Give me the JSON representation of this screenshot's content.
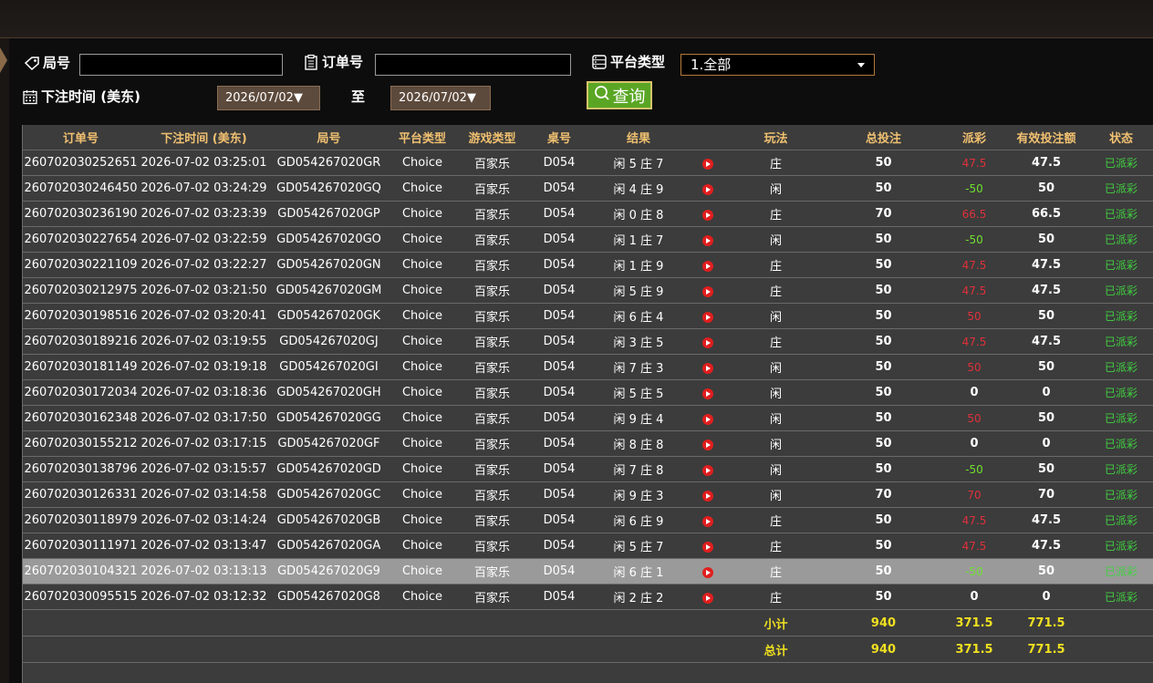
{
  "filters": {
    "round_label": "局号",
    "order_label": "订单号",
    "platform_label": "平台类型",
    "platform_selected": "1.全部",
    "time_label": "下注时间 (美东)",
    "date_from": "2026/07/02",
    "date_to": "2026/07/02",
    "to_label": "至",
    "query_label": "查询"
  },
  "table": {
    "headers": [
      "订单号",
      "下注时间 (美东)",
      "局号",
      "平台类型",
      "游戏类型",
      "桌号",
      "结果",
      "",
      "玩法",
      "总投注",
      "派彩",
      "有效投注额",
      "状态"
    ],
    "rows": [
      {
        "order": "260702030252651",
        "time": "2026-07-02 03:25:01",
        "round": "GD054267020GR",
        "platform": "Choice",
        "game": "百家乐",
        "table": "D054",
        "result": "闲 5 庄 7",
        "play": "庄",
        "bet": "50",
        "payout": "47.5",
        "payout_color": "red",
        "valid": "47.5",
        "status": "已派彩"
      },
      {
        "order": "260702030246450",
        "time": "2026-07-02 03:24:29",
        "round": "GD054267020GQ",
        "platform": "Choice",
        "game": "百家乐",
        "table": "D054",
        "result": "闲 4 庄 9",
        "play": "闲",
        "bet": "50",
        "payout": "-50",
        "payout_color": "green",
        "valid": "50",
        "status": "已派彩"
      },
      {
        "order": "260702030236190",
        "time": "2026-07-02 03:23:39",
        "round": "GD054267020GP",
        "platform": "Choice",
        "game": "百家乐",
        "table": "D054",
        "result": "闲 0 庄 8",
        "play": "庄",
        "bet": "70",
        "payout": "66.5",
        "payout_color": "red",
        "valid": "66.5",
        "status": "已派彩"
      },
      {
        "order": "260702030227654",
        "time": "2026-07-02 03:22:59",
        "round": "GD054267020GO",
        "platform": "Choice",
        "game": "百家乐",
        "table": "D054",
        "result": "闲 1 庄 7",
        "play": "闲",
        "bet": "50",
        "payout": "-50",
        "payout_color": "green",
        "valid": "50",
        "status": "已派彩"
      },
      {
        "order": "260702030221109",
        "time": "2026-07-02 03:22:27",
        "round": "GD054267020GN",
        "platform": "Choice",
        "game": "百家乐",
        "table": "D054",
        "result": "闲 1 庄 9",
        "play": "庄",
        "bet": "50",
        "payout": "47.5",
        "payout_color": "red",
        "valid": "47.5",
        "status": "已派彩"
      },
      {
        "order": "260702030212975",
        "time": "2026-07-02 03:21:50",
        "round": "GD054267020GM",
        "platform": "Choice",
        "game": "百家乐",
        "table": "D054",
        "result": "闲 5 庄 9",
        "play": "庄",
        "bet": "50",
        "payout": "47.5",
        "payout_color": "red",
        "valid": "47.5",
        "status": "已派彩"
      },
      {
        "order": "260702030198516",
        "time": "2026-07-02 03:20:41",
        "round": "GD054267020GK",
        "platform": "Choice",
        "game": "百家乐",
        "table": "D054",
        "result": "闲 6 庄 4",
        "play": "闲",
        "bet": "50",
        "payout": "50",
        "payout_color": "red",
        "valid": "50",
        "status": "已派彩"
      },
      {
        "order": "260702030189216",
        "time": "2026-07-02 03:19:55",
        "round": "GD054267020GJ",
        "platform": "Choice",
        "game": "百家乐",
        "table": "D054",
        "result": "闲 3 庄 5",
        "play": "庄",
        "bet": "50",
        "payout": "47.5",
        "payout_color": "red",
        "valid": "47.5",
        "status": "已派彩"
      },
      {
        "order": "260702030181149",
        "time": "2026-07-02 03:19:18",
        "round": "GD054267020GI",
        "platform": "Choice",
        "game": "百家乐",
        "table": "D054",
        "result": "闲 7 庄 3",
        "play": "闲",
        "bet": "50",
        "payout": "50",
        "payout_color": "red",
        "valid": "50",
        "status": "已派彩"
      },
      {
        "order": "260702030172034",
        "time": "2026-07-02 03:18:36",
        "round": "GD054267020GH",
        "platform": "Choice",
        "game": "百家乐",
        "table": "D054",
        "result": "闲 5 庄 5",
        "play": "闲",
        "bet": "50",
        "payout": "0",
        "payout_color": "white",
        "valid": "0",
        "status": "已派彩"
      },
      {
        "order": "260702030162348",
        "time": "2026-07-02 03:17:50",
        "round": "GD054267020GG",
        "platform": "Choice",
        "game": "百家乐",
        "table": "D054",
        "result": "闲 9 庄 4",
        "play": "闲",
        "bet": "50",
        "payout": "50",
        "payout_color": "red",
        "valid": "50",
        "status": "已派彩"
      },
      {
        "order": "260702030155212",
        "time": "2026-07-02 03:17:15",
        "round": "GD054267020GF",
        "platform": "Choice",
        "game": "百家乐",
        "table": "D054",
        "result": "闲 8 庄 8",
        "play": "闲",
        "bet": "50",
        "payout": "0",
        "payout_color": "white",
        "valid": "0",
        "status": "已派彩"
      },
      {
        "order": "260702030138796",
        "time": "2026-07-02 03:15:57",
        "round": "GD054267020GD",
        "platform": "Choice",
        "game": "百家乐",
        "table": "D054",
        "result": "闲 7 庄 8",
        "play": "闲",
        "bet": "50",
        "payout": "-50",
        "payout_color": "green",
        "valid": "50",
        "status": "已派彩"
      },
      {
        "order": "260702030126331",
        "time": "2026-07-02 03:14:58",
        "round": "GD054267020GC",
        "platform": "Choice",
        "game": "百家乐",
        "table": "D054",
        "result": "闲 9 庄 3",
        "play": "闲",
        "bet": "70",
        "payout": "70",
        "payout_color": "red",
        "valid": "70",
        "status": "已派彩"
      },
      {
        "order": "260702030118979",
        "time": "2026-07-02 03:14:24",
        "round": "GD054267020GB",
        "platform": "Choice",
        "game": "百家乐",
        "table": "D054",
        "result": "闲 6 庄 9",
        "play": "庄",
        "bet": "50",
        "payout": "47.5",
        "payout_color": "red",
        "valid": "47.5",
        "status": "已派彩"
      },
      {
        "order": "260702030111971",
        "time": "2026-07-02 03:13:47",
        "round": "GD054267020GA",
        "platform": "Choice",
        "game": "百家乐",
        "table": "D054",
        "result": "闲 5 庄 7",
        "play": "庄",
        "bet": "50",
        "payout": "47.5",
        "payout_color": "red",
        "valid": "47.5",
        "status": "已派彩"
      },
      {
        "order": "260702030104321",
        "time": "2026-07-02 03:13:13",
        "round": "GD054267020G9",
        "platform": "Choice",
        "game": "百家乐",
        "table": "D054",
        "result": "闲 6 庄 1",
        "play": "庄",
        "bet": "50",
        "payout": "-50",
        "payout_color": "green",
        "valid": "50",
        "status": "已派彩",
        "highlight": true
      },
      {
        "order": "260702030095515",
        "time": "2026-07-02 03:12:32",
        "round": "GD054267020G8",
        "platform": "Choice",
        "game": "百家乐",
        "table": "D054",
        "result": "闲 2 庄 2",
        "play": "庄",
        "bet": "50",
        "payout": "0",
        "payout_color": "white",
        "valid": "0",
        "status": "已派彩"
      }
    ],
    "subtotal": {
      "label": "小计",
      "bet": "940",
      "payout": "371.5",
      "valid": "771.5"
    },
    "total": {
      "label": "总计",
      "bet": "940",
      "payout": "371.5",
      "valid": "771.5"
    }
  },
  "colors": {
    "header_text": "#f0c070",
    "payout_red": "#e0303a",
    "payout_green": "#70e030",
    "status_green": "#40d040",
    "summary_yellow": "#f0e020",
    "query_button": "#5aa624",
    "highlight_row": "#9a9a9a"
  },
  "icons": {
    "round": "tag-icon",
    "order": "clipboard-icon",
    "platform": "server-icon",
    "time": "calendar-icon",
    "query": "search-icon",
    "replay": "play-icon"
  }
}
